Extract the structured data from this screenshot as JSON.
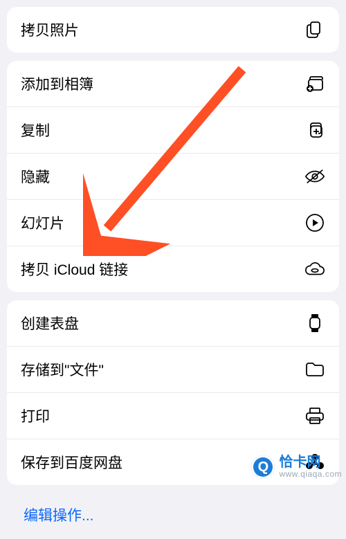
{
  "groups": [
    {
      "items": [
        {
          "key": "copy-photo",
          "label": "拷贝照片",
          "icon": "copy-doc-icon"
        }
      ]
    },
    {
      "items": [
        {
          "key": "add-to-album",
          "label": "添加到相簿",
          "icon": "album-add-icon"
        },
        {
          "key": "duplicate",
          "label": "复制",
          "icon": "duplicate-icon"
        },
        {
          "key": "hide",
          "label": "隐藏",
          "icon": "eye-off-icon"
        },
        {
          "key": "slideshow",
          "label": "幻灯片",
          "icon": "play-circle-icon"
        },
        {
          "key": "copy-icloud-link",
          "label": "拷贝 iCloud 链接",
          "icon": "cloud-link-icon"
        }
      ]
    },
    {
      "items": [
        {
          "key": "create-watch-face",
          "label": "创建表盘",
          "icon": "watch-icon"
        },
        {
          "key": "save-to-files",
          "label": "存储到\"文件\"",
          "icon": "folder-icon"
        },
        {
          "key": "print",
          "label": "打印",
          "icon": "printer-icon"
        },
        {
          "key": "save-to-baidu",
          "label": "保存到百度网盘",
          "icon": "baidu-pan-icon"
        }
      ]
    }
  ],
  "edit_label": "编辑操作...",
  "arrow_color": "#ff4f25",
  "watermark": {
    "brand": "恰卡网",
    "domain": "www.qiaqa.com"
  }
}
